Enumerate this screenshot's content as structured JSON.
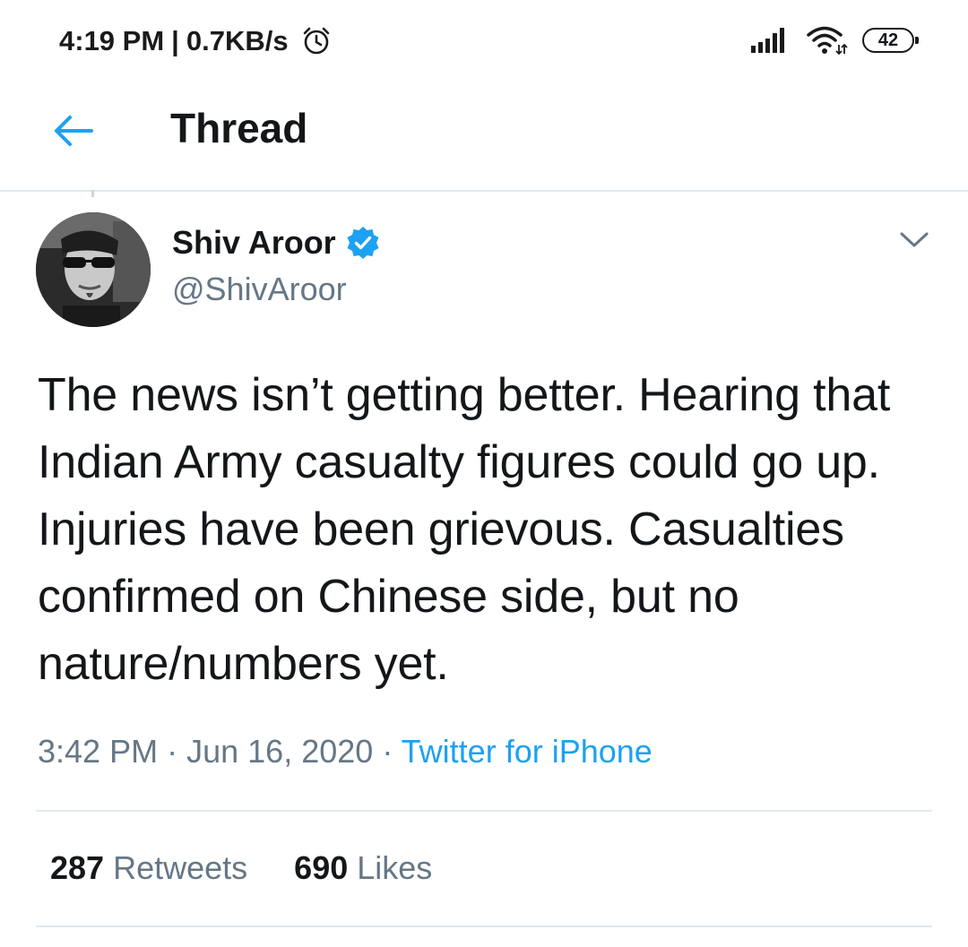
{
  "status_bar": {
    "time": "4:19 PM",
    "separator": "|",
    "network_speed": "0.7KB/s",
    "battery": "42",
    "icons": [
      "alarm-icon",
      "signal-icon",
      "wifi-icon",
      "battery-icon"
    ]
  },
  "header": {
    "title": "Thread",
    "back_icon": "back-arrow-icon"
  },
  "tweet": {
    "author_name": "Shiv Aroor",
    "author_handle": "@ShivAroor",
    "verified": true,
    "text": "The news isn’t getting better. Hearing that Indian Army casualty figures could go up. Injuries have been grievous. Casualties confirmed on Chinese side, but no nature/numbers yet.",
    "time": "3:42 PM",
    "date": "Jun 16, 2020",
    "dot": "·",
    "source": "Twitter for iPhone",
    "retweets_count": "287",
    "retweets_label": "Retweets",
    "likes_count": "690",
    "likes_label": "Likes"
  },
  "colors": {
    "accent": "#1da1f2",
    "secondary_text": "#657786",
    "primary_text": "#14171a",
    "divider": "#e1e8ed"
  }
}
